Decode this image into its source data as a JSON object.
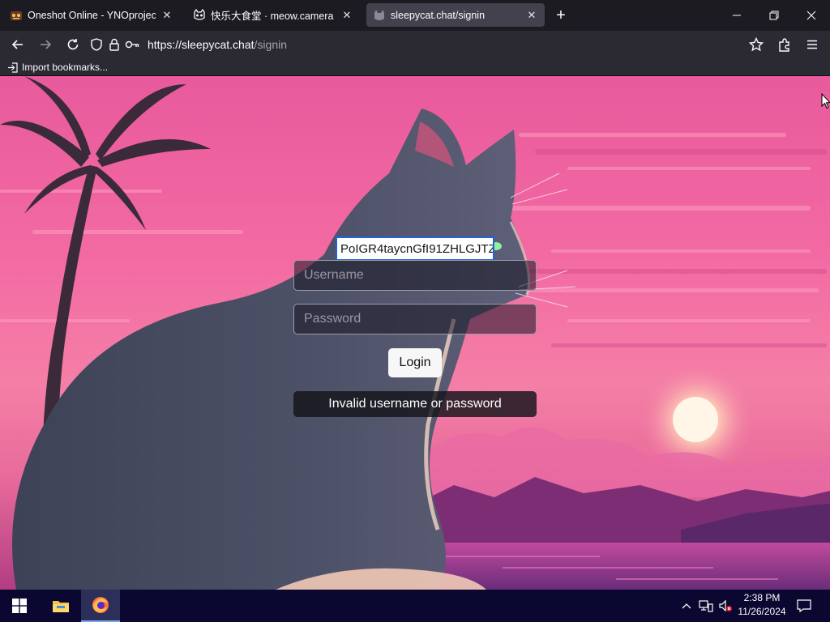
{
  "browser": {
    "tabs": [
      {
        "title": "Oneshot Online - YNOproject",
        "favicon": "ynoproject-icon",
        "active": false
      },
      {
        "title": "快乐大食堂 · meow.camera",
        "favicon": "cat-outline-icon",
        "active": false
      },
      {
        "title": "sleepycat.chat/signin",
        "favicon": "cat-favicon-icon",
        "active": true
      }
    ],
    "new_tab_symbol": "+",
    "address": {
      "host": "https://sleepycat.chat",
      "path": "/signin"
    },
    "bookmarks": [
      {
        "label": "Import bookmarks...",
        "icon": "import-icon"
      }
    ]
  },
  "page": {
    "autofill_text_before": "PoIGR4taycnGfI91",
    "autofill_text_after": "ZHLGJTZ",
    "username_placeholder": "Username",
    "password_placeholder": "Password",
    "login_label": "Login",
    "error_message": "Invalid username or password"
  },
  "taskbar": {
    "apps": [
      {
        "name": "File Explorer",
        "icon": "folder-icon"
      },
      {
        "name": "Firefox",
        "icon": "firefox-icon"
      }
    ],
    "clock": {
      "time": "2:38 PM",
      "date": "11/26/2024"
    }
  },
  "colors": {
    "tab_strip": "#1c1b22",
    "toolbar": "#2b2a33",
    "sky_pink": "#f0609c",
    "taskbar": "#0a0730",
    "focus_blue": "#1f66d6"
  }
}
